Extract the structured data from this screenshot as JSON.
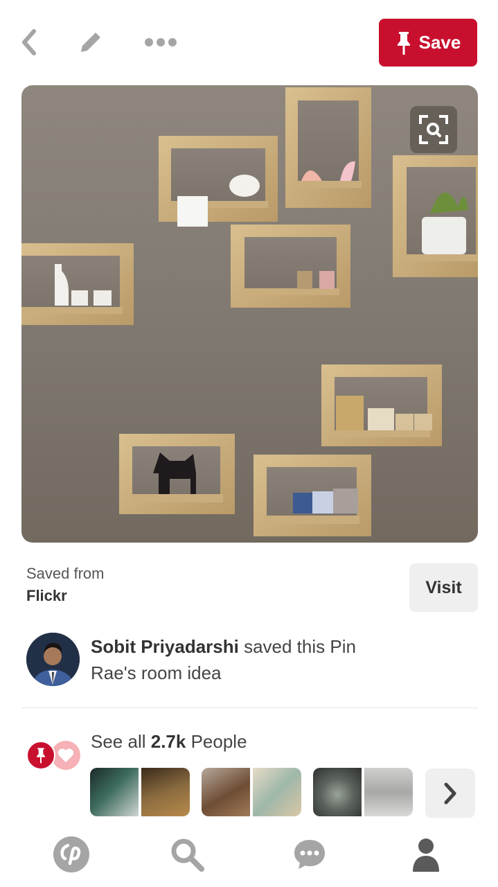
{
  "header": {
    "back_icon": "chevron-left-icon",
    "edit_icon": "pencil-icon",
    "more_icon": "ellipsis-icon",
    "save_label": "Save",
    "accent_color": "#c8102e"
  },
  "pin": {
    "image_icon": "visual-search-icon"
  },
  "source": {
    "saved_from_label": "Saved from",
    "site_name": "Flickr",
    "visit_label": "Visit"
  },
  "saver": {
    "name": "Sobit Priyadarshi",
    "action": " saved this Pin",
    "board": "Rae's room idea"
  },
  "people": {
    "prefix": "See all ",
    "count": "2.7k",
    "suffix": " People"
  },
  "nav": {
    "items": [
      "home-icon",
      "search-icon",
      "messages-icon",
      "profile-icon"
    ]
  }
}
